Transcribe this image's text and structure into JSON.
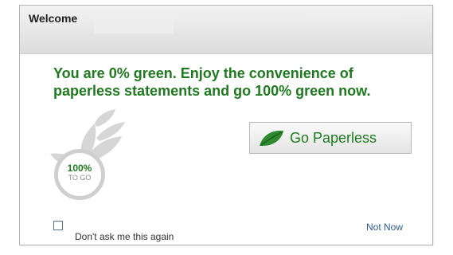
{
  "header": {
    "welcome_label": "Welcome"
  },
  "message": {
    "text": "You are 0% green. Enjoy the convenience of paperless statements and go 100% green now."
  },
  "progress": {
    "percent_label": "100%",
    "sub_label": "TO GO",
    "remaining_percent": 100
  },
  "actions": {
    "go_paperless_label": "Go Paperless",
    "not_now_label": "Not Now"
  },
  "options": {
    "dont_ask_label": "Don't ask me this again",
    "dont_ask_checked": false
  },
  "colors": {
    "accent_green": "#1e7a1e",
    "link_blue": "#2a5b97",
    "plant_gray": "#d6d6d6"
  },
  "icons": {
    "leaf": "leaf-icon",
    "plant": "plant-icon"
  }
}
